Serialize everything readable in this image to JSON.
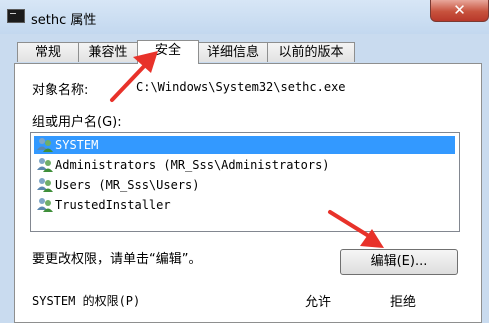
{
  "window": {
    "title": "sethc 属性",
    "close_symbol": "✕"
  },
  "tabs": [
    {
      "label": "常规",
      "active": false
    },
    {
      "label": "兼容性",
      "active": false
    },
    {
      "label": "安全",
      "active": true
    },
    {
      "label": "详细信息",
      "active": false
    },
    {
      "label": "以前的版本",
      "active": false
    }
  ],
  "security": {
    "object_label": "对象名称:",
    "object_value": "C:\\Windows\\System32\\sethc.exe",
    "group_label": "组或用户名(G):",
    "users": [
      {
        "name": "SYSTEM",
        "selected": true
      },
      {
        "name": "Administrators (MR_Sss\\Administrators)",
        "selected": false
      },
      {
        "name": "Users (MR_Sss\\Users)",
        "selected": false
      },
      {
        "name": "TrustedInstaller",
        "selected": false
      }
    ],
    "change_hint": "要更改权限，请单击“编辑”。",
    "edit_button": "编辑(E)...",
    "permissions_label": "SYSTEM 的权限(P)",
    "allow_header": "允许",
    "deny_header": "拒绝"
  },
  "colors": {
    "annotation_arrow": "#e8322a",
    "selection": "#3399ff"
  }
}
